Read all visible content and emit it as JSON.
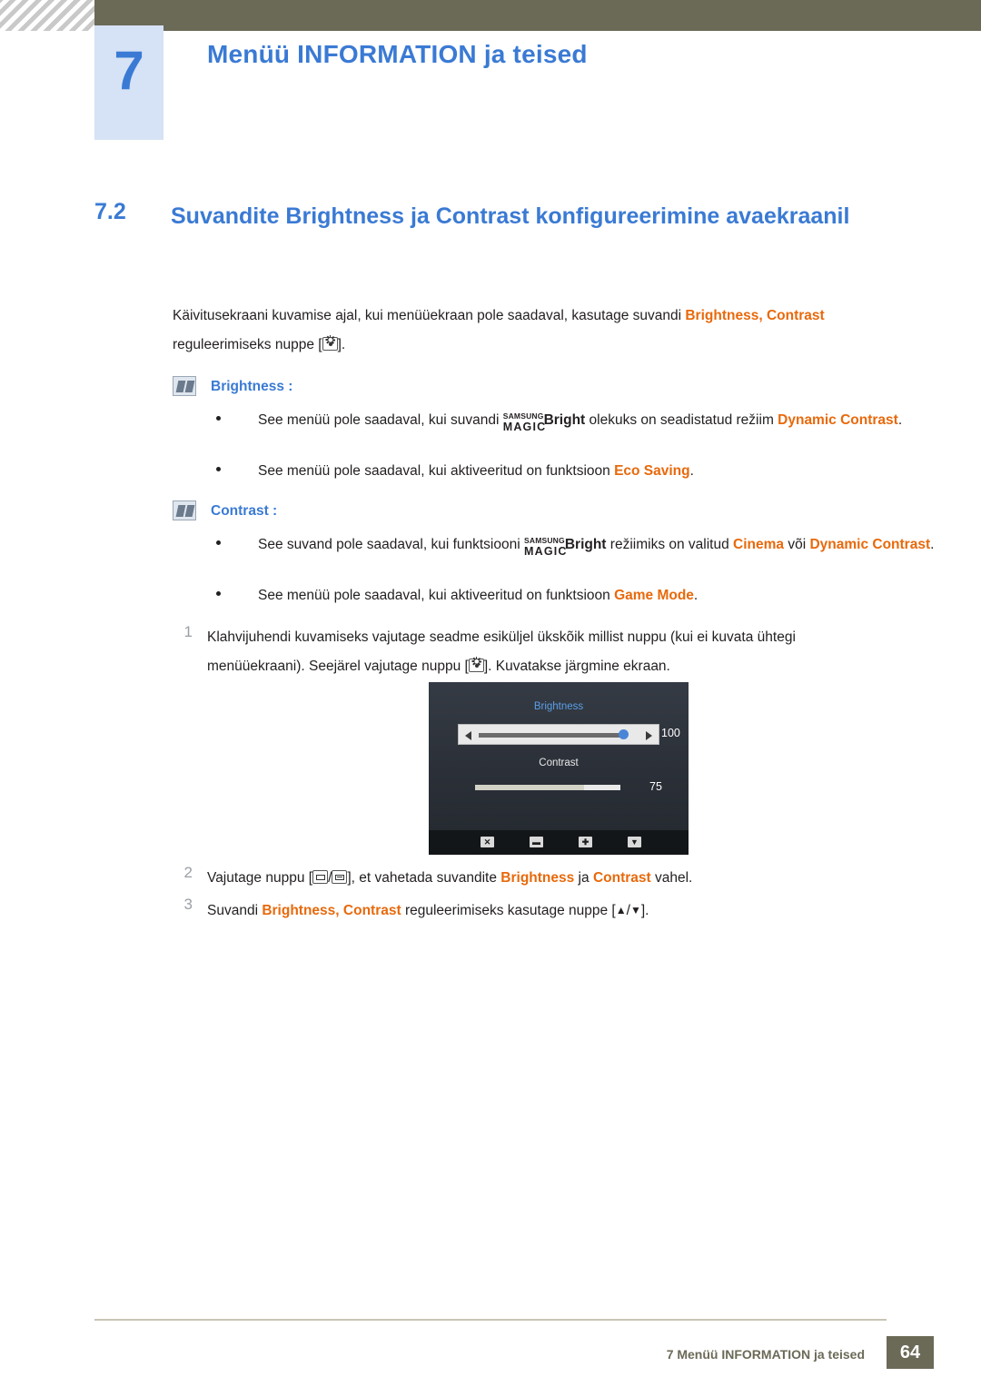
{
  "header": {
    "chapter_number": "7",
    "chapter_title": "Menüü INFORMATION ja teised"
  },
  "section": {
    "number": "7.2",
    "title": "Suvandite Brightness ja Contrast konfigureerimine avaekraanil"
  },
  "intro": {
    "part1": "Käivitusekraani kuvamise ajal, kui menüüekraan pole saadaval, kasutage suvandi ",
    "term1": "Brightness",
    "comma": ", ",
    "term2": "Contrast",
    "part2": " reguleerimiseks nuppe [",
    "part3": "]."
  },
  "notes": [
    {
      "heading": "Brightness :",
      "bullets": [
        {
          "pre": "See menüü pole saadaval, kui suvandi ",
          "magic_sam": "SAMSUNG",
          "magic_mag": "MAGIC",
          "magic_bright": "Bright",
          "mid": " olekuks on seadistatud režiim ",
          "term": "Dynamic Contrast",
          "post": "."
        },
        {
          "pre": "See menüü pole saadaval, kui aktiveeritud on funktsioon ",
          "term": "Eco Saving",
          "post": "."
        }
      ]
    },
    {
      "heading": "Contrast :",
      "bullets": [
        {
          "pre": "See suvand pole saadaval, kui funktsiooni ",
          "magic_sam": "SAMSUNG",
          "magic_mag": "MAGIC",
          "magic_bright": "Bright",
          "mid": " režiimiks on valitud ",
          "term": "Cinema",
          "mid2": " või ",
          "term2": "Dynamic Contrast",
          "post": "."
        },
        {
          "pre": "See menüü pole saadaval, kui aktiveeritud on funktsioon ",
          "term": "Game Mode",
          "post": "."
        }
      ]
    }
  ],
  "steps": [
    {
      "num": "1",
      "line1": "Klahvijuhendi kuvamiseks vajutage seadme esiküljel ükskõik millist nuppu (kui ei kuvata ühtegi",
      "line2a": "menüüekraani). Seejärel vajutage nuppu [",
      "line2b": "]. Kuvatakse järgmine ekraan."
    },
    {
      "num": "2",
      "pre": "Vajutage nuppu [",
      "mid": "], et vahetada suvandite ",
      "term1": "Brightness",
      "and": " ja ",
      "term2": "Contrast",
      "post": " vahel."
    },
    {
      "num": "3",
      "pre": "Suvandi ",
      "term1": "Brightness",
      "comma": ", ",
      "term2": "Contrast",
      "mid": " reguleerimiseks kasutage nuppe [",
      "arrow_up": "▲",
      "slash": "/",
      "arrow_down": "▼",
      "post": "]."
    }
  ],
  "osd": {
    "title": "Brightness",
    "value1": "100",
    "subtitle": "Contrast",
    "value2": "75",
    "footer_keys": [
      "✕",
      "▬",
      "✚",
      "▼"
    ]
  },
  "footer": {
    "text": "7 Menüü INFORMATION ja teised",
    "page": "64"
  },
  "colors": {
    "accent_blue": "#3a7ad4",
    "term_orange": "#e8690b",
    "header_olive": "#6b6a57",
    "badge_blue": "#d6e2f5"
  }
}
